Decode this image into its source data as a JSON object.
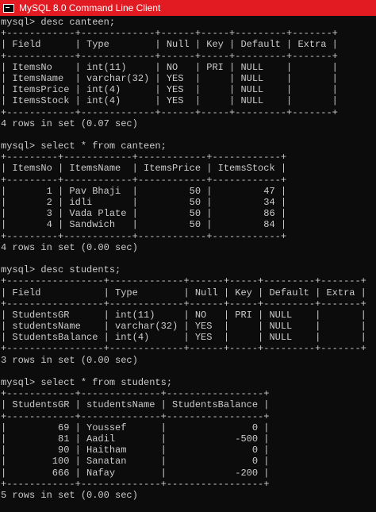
{
  "window": {
    "title": "MySQL 8.0 Command Line Client",
    "icon": "console-icon",
    "colors": {
      "titlebar": "#e21b23",
      "background": "#0c0c0c",
      "text": "#cccccc"
    }
  },
  "console": {
    "lines": [
      "mysql> desc canteen;",
      "+------------+-------------+------+-----+---------+-------+",
      "| Field      | Type        | Null | Key | Default | Extra |",
      "+------------+-------------+------+-----+---------+-------+",
      "| ItemsNo    | int(11)     | NO   | PRI | NULL    |       |",
      "| ItemsName  | varchar(32) | YES  |     | NULL    |       |",
      "| ItemsPrice | int(4)      | YES  |     | NULL    |       |",
      "| ItemsStock | int(4)      | YES  |     | NULL    |       |",
      "+------------+-------------+------+-----+---------+-------+",
      "4 rows in set (0.07 sec)",
      "",
      "mysql> select * from canteen;",
      "+---------+------------+------------+------------+",
      "| ItemsNo | ItemsName  | ItemsPrice | ItemsStock |",
      "+---------+------------+------------+------------+",
      "|       1 | Pav Bhaji  |         50 |         47 |",
      "|       2 | idli       |         50 |         34 |",
      "|       3 | Vada Plate |         50 |         86 |",
      "|       4 | Sandwich   |         50 |         84 |",
      "+---------+------------+------------+------------+",
      "4 rows in set (0.00 sec)",
      "",
      "mysql> desc students;",
      "+-----------------+-------------+------+-----+---------+-------+",
      "| Field           | Type        | Null | Key | Default | Extra |",
      "+-----------------+-------------+------+-----+---------+-------+",
      "| StudentsGR      | int(11)     | NO   | PRI | NULL    |       |",
      "| studentsName    | varchar(32) | YES  |     | NULL    |       |",
      "| StudentsBalance | int(4)      | YES  |     | NULL    |       |",
      "+-----------------+-------------+------+-----+---------+-------+",
      "3 rows in set (0.00 sec)",
      "",
      "mysql> select * from students;",
      "+------------+--------------+-----------------+",
      "| StudentsGR | studentsName | StudentsBalance |",
      "+------------+--------------+-----------------+",
      "|         69 | Youssef      |               0 |",
      "|         81 | Aadil        |            -500 |",
      "|         90 | Haitham      |               0 |",
      "|        100 | Sanatan      |               0 |",
      "|        666 | Nafay        |            -200 |",
      "+------------+--------------+-----------------+",
      "5 rows in set (0.00 sec)"
    ]
  }
}
